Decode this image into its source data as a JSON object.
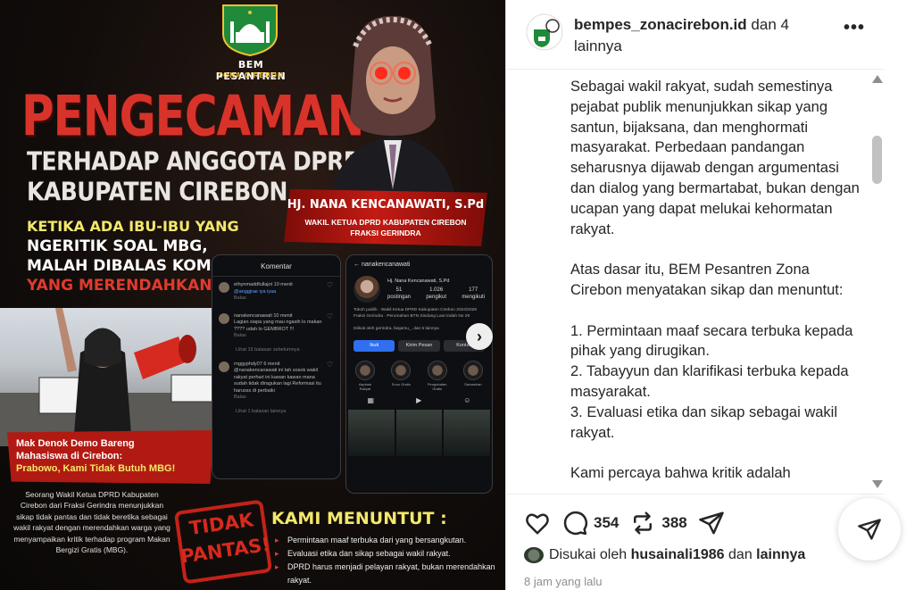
{
  "poster": {
    "org_name": "BEM PESANTREN",
    "org_sub": "ZONA CIREBON",
    "headline": "PENGECAMAN",
    "sub_line1": "TERHADAP ANGGOTA DPRD",
    "sub_line2": "KABUPATEN CIREBON",
    "tagline1": "KETIKA ADA IBU-IBU YANG",
    "tagline2": "NGERITIK SOAL MBG,",
    "tagline3": "MALAH DIBALAS KOMEN",
    "tagline4": "YANG MERENDAHKAN!",
    "person_name": "HJ. NANA KENCANAWATI, S.Pd",
    "person_role1": "WAKIL KETUA DPRD KABUPATEN CIREBON",
    "person_role2": "FRAKSI GERINDRA",
    "demo_caption1": "Mak Denok Demo Bareng",
    "demo_caption2": "Mahasiswa di Cirebon:",
    "demo_caption3": "Prabowo, Kami Tidak Butuh MBG!",
    "description": "Seorang Wakil Ketua DPRD Kabupaten Cirebon dari Fraksi Gerindra menunjukkan sikap tidak pantas dan tidak beretika sebagai wakil rakyat dengan merendahkan warga yang menyampaikan kritik terhadap program Makan Bergizi Gratis (MBG).",
    "stamp": "TIDAK PANTAS!",
    "demands_title": "KAMI MENUNTUT :",
    "demands": [
      "Permintaan maaf terbuka dari yang bersangkutan.",
      "Evaluasi etika dan sikap sebagai wakil rakyat.",
      "DPRD harus menjadi pelayan rakyat, bukan merendahkan rakyat."
    ],
    "phone1": {
      "title": "Komentar",
      "comments": [
        {
          "user": "ethynmaddfullajot",
          "time": "10 menit",
          "text": "@anggjrae iya iyaa",
          "reply": "Balas"
        },
        {
          "user": "nanakencanawati",
          "time": "10 menit",
          "text": "Lagian siapa yang mau ngasih lo makan ???? udah lo GEMBROT !!!",
          "reply": "Balas"
        },
        {
          "user": "rnggyphdy07",
          "time": "6 menit",
          "text": "@nanakencanawati ini lah sosok wakil rakyat perhari ini kawan kawan mana sudah tidak diragukan lagi Reformasi itu harusss di perbaiki",
          "reply": "Balas"
        }
      ],
      "more1": "Lihat 15 balasan sebelumnya",
      "more2": "Lihat 1 balasan lainnya"
    },
    "phone2": {
      "username": "nanakencanawati",
      "display_name": "Hj. Nana Kencanawati, S.Pd",
      "posts": "51",
      "posts_label": "postingan",
      "followers": "1.026",
      "followers_label": "pengikut",
      "following": "177",
      "following_label": "mengikuti",
      "bio": "Tokoh publik · Wakil Ketua DPRD Kabupaten Cirebon 2024/2029 Fraksi Gerindra · Perumahan BTN Sindang Laut Indah No 28",
      "followed_by": "Diikuti oleh gerindra, fasjamu_, dan 5 lainnya",
      "btn_follow": "Ikuti",
      "btn_message": "Kirim Pesan",
      "btn_contact": "Kontak",
      "highlights": [
        "Aspirasi Rakyat",
        "Sunu Gratis",
        "Pengobatan Gratis",
        "Sarasehan"
      ]
    }
  },
  "instagram": {
    "username": "bempes_zonacirebon.id",
    "with_others": "dan 4 lainnya",
    "caption": "Sebagai wakil rakyat, sudah semestinya pejabat publik menunjukkan sikap yang santun, bijaksana, dan menghormati masyarakat. Perbedaan pandangan seharusnya dijawab dengan argumentasi dan dialog yang bermartabat, bukan dengan ucapan yang dapat melukai kehormatan rakyat.\n\nAtas dasar itu, BEM Pesantren Zona Cirebon menyatakan sikap dan menuntut:\n\n1.  Permintaan maaf secara terbuka kepada pihak yang dirugikan.\n2. Tabayyun dan klarifikasi terbuka kepada masyarakat.\n3. Evaluasi etika dan sikap sebagai wakil rakyat.\n\nKami percaya bahwa kritik adalah",
    "comments_count": "354",
    "reposts_count": "388",
    "liked_by_prefix": "Disukai oleh",
    "liked_by_user": "husainali1986",
    "liked_by_conj": "dan",
    "liked_by_suffix": "lainnya",
    "time_ago": "8 jam yang lalu"
  },
  "icons": [
    "heart-icon",
    "comment-icon",
    "repost-icon",
    "send-icon",
    "more-icon",
    "share-icon",
    "next-arrow-icon"
  ]
}
